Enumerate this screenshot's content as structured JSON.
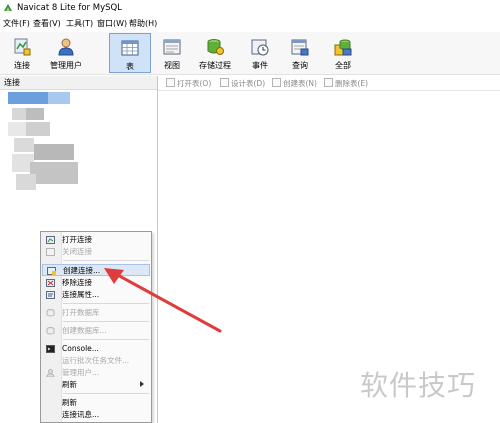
{
  "window": {
    "title": "Navicat 8 Lite for MySQL"
  },
  "menubar": {
    "items": [
      "文件(F)",
      "查看(V)",
      "工具(T)",
      "窗口(W)",
      "帮助(H)"
    ]
  },
  "toolbar": {
    "buttons": [
      {
        "label": "连接",
        "icon": "connection-icon"
      },
      {
        "label": "管理用户",
        "icon": "user-icon"
      },
      {
        "label": "表",
        "icon": "table-icon",
        "active": true
      },
      {
        "label": "视图",
        "icon": "view-icon"
      },
      {
        "label": "存储过程",
        "icon": "stored-procedure-icon"
      },
      {
        "label": "事件",
        "icon": "event-clock-icon"
      },
      {
        "label": "查询",
        "icon": "query-icon"
      },
      {
        "label": "全部",
        "icon": "all-objects-icon"
      }
    ]
  },
  "left_pane": {
    "header": "连接"
  },
  "object_toolbar": {
    "buttons": [
      "打开表(O)",
      "设计表(D)",
      "创建表(N)",
      "删除表(E)"
    ]
  },
  "context_menu": {
    "items": [
      {
        "label": "打开连接",
        "enabled": true
      },
      {
        "label": "关闭连接",
        "enabled": false
      },
      {
        "label": "创建连接...",
        "enabled": true,
        "highlighted": true
      },
      {
        "label": "移除连接",
        "enabled": true
      },
      {
        "label": "连接属性...",
        "enabled": true
      },
      {
        "label": "打开数据库",
        "enabled": false
      },
      {
        "label": "创建数据库...",
        "enabled": false
      },
      {
        "label": "Console...",
        "enabled": true
      },
      {
        "label": "运行批次任务文件...",
        "enabled": false
      },
      {
        "label": "管理用户...",
        "enabled": false
      },
      {
        "label": "刷新",
        "enabled": true,
        "submenu": true
      },
      {
        "label": "刷新",
        "enabled": true
      },
      {
        "label": "连接讯息...",
        "enabled": true
      }
    ]
  },
  "watermark": "软件技巧",
  "colors": {
    "active_button_bg": "#cfe2f8",
    "highlight": "#dde8f6",
    "annotation_arrow": "#e03c3c"
  }
}
